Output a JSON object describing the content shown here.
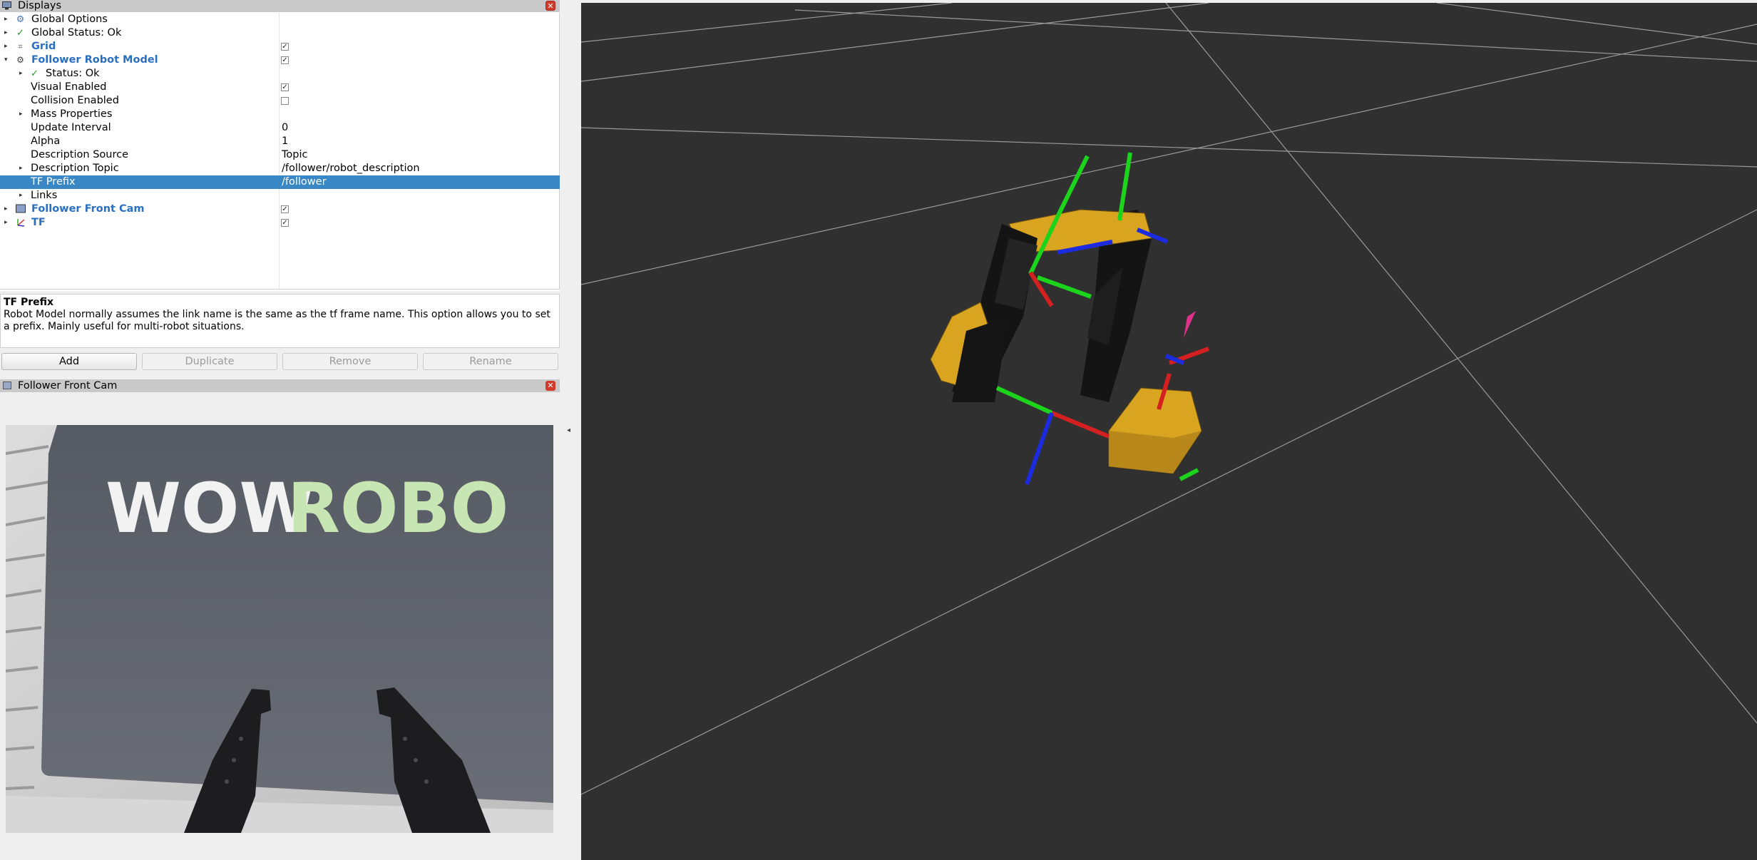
{
  "displays": {
    "title": "Displays",
    "close": "✕",
    "rows": [
      {
        "label": "Global Options",
        "value": ""
      },
      {
        "label": "Global Status: Ok",
        "value": ""
      },
      {
        "label": "Grid",
        "checked": true
      },
      {
        "label": "Follower Robot Model",
        "checked": true
      },
      {
        "label": "Status: Ok",
        "value": ""
      },
      {
        "label": "Visual Enabled",
        "checked": true
      },
      {
        "label": "Collision Enabled",
        "checked": false
      },
      {
        "label": "Mass Properties",
        "value": ""
      },
      {
        "label": "Update Interval",
        "value": "0"
      },
      {
        "label": "Alpha",
        "value": "1"
      },
      {
        "label": "Description Source",
        "value": "Topic"
      },
      {
        "label": "Description Topic",
        "value": "/follower/robot_description"
      },
      {
        "label": "TF Prefix",
        "value": "/follower"
      },
      {
        "label": "Links",
        "value": ""
      },
      {
        "label": "Follower Front Cam",
        "checked": true
      },
      {
        "label": "TF",
        "checked": true
      }
    ]
  },
  "description": {
    "title": "TF Prefix",
    "text": "Robot Model normally assumes the link name is the same as the tf frame name. This option allows you to set a prefix. Mainly useful for multi-robot situations."
  },
  "buttons": {
    "add": "Add",
    "duplicate": "Duplicate",
    "remove": "Remove",
    "rename": "Rename"
  },
  "camera": {
    "title": "Follower Front Cam",
    "close": "✕",
    "sign_text_left": "WOW",
    "sign_text_right": "ROBO"
  },
  "colors": {
    "selection": "#3a87c6",
    "blue_label": "#2a6fc2",
    "view_bg": "#303030",
    "robot_yellow": "#d9a520"
  }
}
